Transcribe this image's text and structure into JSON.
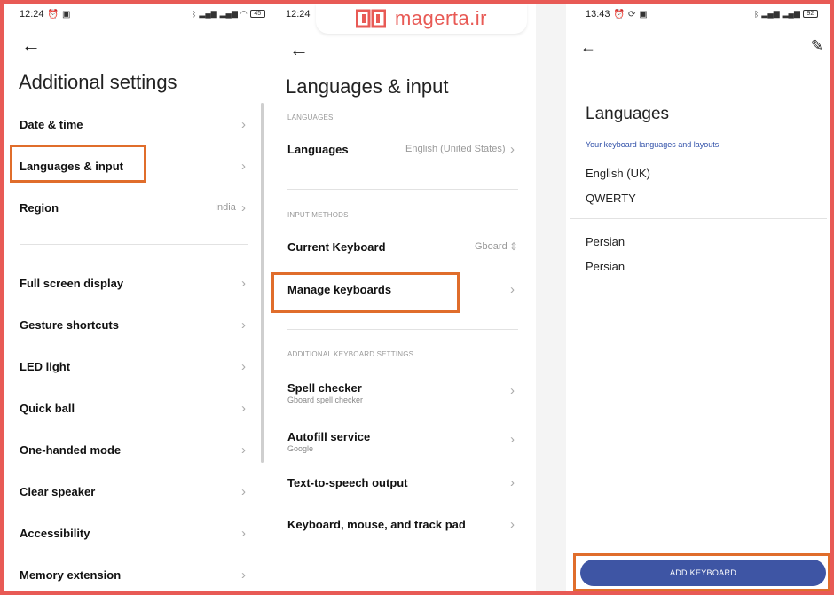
{
  "watermark": {
    "text": "magerta.ir"
  },
  "screen1": {
    "status_time": "12:24",
    "battery": "45",
    "title": "Additional settings",
    "items": [
      {
        "label": "Date & time",
        "value": ""
      },
      {
        "label": "Languages & input",
        "value": ""
      },
      {
        "label": "Region",
        "value": "India"
      },
      {
        "label": "Full screen display",
        "value": ""
      },
      {
        "label": "Gesture shortcuts",
        "value": ""
      },
      {
        "label": "LED light",
        "value": ""
      },
      {
        "label": "Quick ball",
        "value": ""
      },
      {
        "label": "One-handed mode",
        "value": ""
      },
      {
        "label": "Clear speaker",
        "value": ""
      },
      {
        "label": "Accessibility",
        "value": ""
      },
      {
        "label": "Memory extension",
        "value": ""
      }
    ]
  },
  "screen2": {
    "status_time": "12:24",
    "title": "Languages & input",
    "section_languages": "LANGUAGES",
    "section_input": "INPUT METHODS",
    "section_additional": "ADDITIONAL KEYBOARD SETTINGS",
    "languages": {
      "label": "Languages",
      "value": "English (United States)"
    },
    "current_keyboard": {
      "label": "Current Keyboard",
      "value": "Gboard"
    },
    "manage_keyboards": {
      "label": "Manage keyboards"
    },
    "spell_checker": {
      "label": "Spell checker",
      "sub": "Gboard spell checker"
    },
    "autofill": {
      "label": "Autofill service",
      "sub": "Google"
    },
    "tts": {
      "label": "Text-to-speech output"
    },
    "keyboard_mouse": {
      "label": "Keyboard, mouse, and track pad"
    }
  },
  "screen3": {
    "status_time": "13:43",
    "battery": "92",
    "title": "Languages",
    "subtitle": "Your keyboard languages and layouts",
    "lang1": {
      "name": "English (UK)",
      "layout": "QWERTY"
    },
    "lang2": {
      "name": "Persian",
      "layout": "Persian"
    },
    "add_button": "ADD KEYBOARD"
  },
  "colors": {
    "border": "#e85a55",
    "highlight": "#e06d2b",
    "button": "#3e55a4",
    "subtitle": "#2f4fa8"
  }
}
